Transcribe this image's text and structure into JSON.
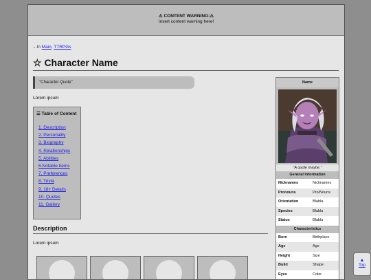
{
  "warning": {
    "title": "⚠ CONTENT WARNING:⚠",
    "text": "Insert content warning here!"
  },
  "breadcrumb": {
    "prefix": "...In ",
    "links": [
      "Main",
      "TTRPGs"
    ],
    "sep": ", "
  },
  "page_title": "☆ Character Name",
  "quote": "\"Character Quote\"",
  "intro_text": "Lorem ipsum",
  "toc": {
    "icon": "☰",
    "title": "Table of Content",
    "items": [
      "1. Description",
      "2. Personality",
      "3. Biography",
      "4. Relationships",
      "5. Abilities",
      "6.Notable Items",
      "7. Preferences",
      "8. Trivia",
      "9. 18+ Details",
      "10. Quotes",
      "11. Gallery"
    ]
  },
  "description": {
    "heading": "Description",
    "text": "Lorem ipsum"
  },
  "infobox": {
    "name": "Name",
    "caption": "\"A quote maybe.\"",
    "general_heading": "General Information",
    "general": [
      {
        "k": "Nicknames",
        "v": "Nicknames"
      },
      {
        "k": "Pronouns",
        "v": "Pro/Nouns"
      },
      {
        "k": "Orientation",
        "v": "Blabla"
      },
      {
        "k": "Species",
        "v": "Blabla"
      },
      {
        "k": "Status",
        "v": "Blabla"
      }
    ],
    "char_heading": "Characteristics",
    "characteristics": [
      {
        "k": "Born",
        "v": "Birthplace"
      },
      {
        "k": "Age",
        "v": "Age"
      },
      {
        "k": "Height",
        "v": "Size"
      },
      {
        "k": "Build",
        "v": "Shape"
      },
      {
        "k": "Eyes",
        "v": "Color"
      }
    ]
  },
  "top_button": {
    "arrow": "▲",
    "label": "Top"
  },
  "colors": {
    "link": "#1a1aee",
    "panel": "#bdbdbd",
    "page": "#e6e6e6",
    "backdrop": "#8e8e8e"
  }
}
